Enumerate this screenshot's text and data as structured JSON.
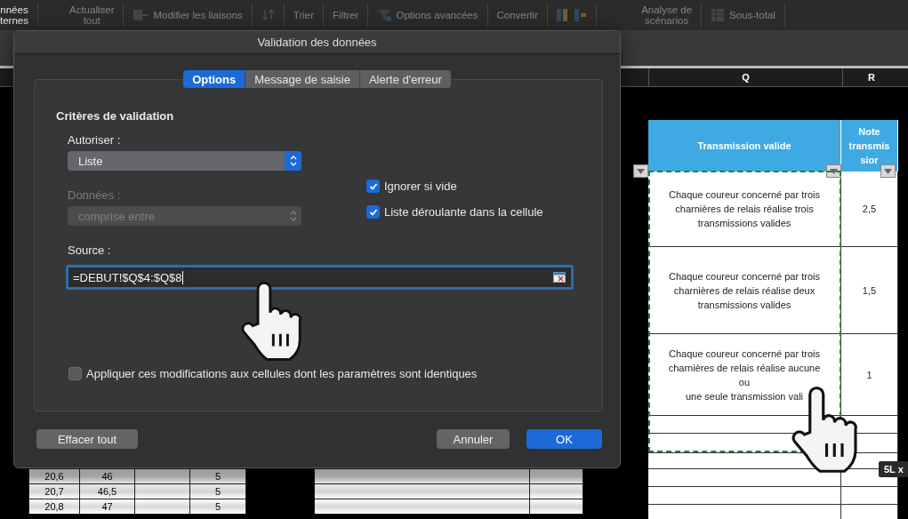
{
  "toolbar": {
    "items": [
      {
        "kind": "text",
        "label": "nnées\nternes",
        "disabled": false
      },
      {
        "kind": "text",
        "label": "Actualiser\ntout",
        "disabled": true
      },
      {
        "kind": "link",
        "label": "Modifier les liaisons",
        "disabled": true
      },
      {
        "kind": "sort",
        "disabled": true
      },
      {
        "kind": "text",
        "label": "Trier",
        "disabled": true
      },
      {
        "kind": "text",
        "label": "Filtrer",
        "disabled": true
      },
      {
        "kind": "funnel",
        "label": "Options avancées",
        "disabled": true
      },
      {
        "kind": "text",
        "label": "Convertir",
        "disabled": true
      },
      {
        "kind": "columns",
        "disabled": true
      },
      {
        "kind": "text",
        "label": "Analyse de\nscénarios",
        "disabled": true
      },
      {
        "kind": "table",
        "label": "Sous-total",
        "disabled": true
      }
    ]
  },
  "sheet": {
    "column_headers": [
      "Q",
      "R"
    ],
    "table": {
      "columns": [
        "Transmission valide",
        "Note\ntransmis\nsior"
      ],
      "rows": [
        {
          "text": "Chaque coureur concerné par trois\ncharnières de relais réalise trois\ntransmissions valides",
          "note": "2,5"
        },
        {
          "text": "Chaque coureur concerné par trois\ncharnières de relais réalise deux\ntransmissions valides",
          "note": "1,5"
        },
        {
          "text": "Chaque coureur concerné par trois\ncharnières de relais réalise aucune\nou\nune seule transmission vali",
          "note": "1"
        }
      ]
    },
    "left_table": {
      "rows": [
        {
          "col_1": "20,6",
          "col_2": "46",
          "col_4": "5"
        },
        {
          "col_1": "20,7",
          "col_2": "46,5",
          "col_4": "5"
        },
        {
          "col_1": "20,8",
          "col_2": "47",
          "col_4": "5"
        }
      ]
    },
    "tooltip": "5L x"
  },
  "dialog": {
    "title": "Validation des données",
    "tabs": [
      {
        "label": "Options",
        "selected": true
      },
      {
        "label": "Message de saisie",
        "selected": false
      },
      {
        "label": "Alerte d'erreur",
        "selected": false
      }
    ],
    "section_title": "Critères de validation",
    "allow": {
      "label": "Autoriser :",
      "value": "Liste",
      "disabled": false
    },
    "data": {
      "label": "Données :",
      "value": "comprise entre",
      "disabled": true
    },
    "checkboxes": [
      {
        "label": "Ignorer si vide",
        "checked": true
      },
      {
        "label": "Liste déroulante dans la cellule",
        "checked": true
      }
    ],
    "source": {
      "label": "Source :",
      "value": "=DEBUT!$Q$4:$Q$8"
    },
    "apply": {
      "label": "Appliquer ces modifications aux cellules dont les paramètres sont identiques",
      "checked": false
    },
    "buttons": [
      {
        "label": "Effacer tout",
        "kind": "secondary"
      },
      {
        "label": "Annuler",
        "kind": "secondary"
      },
      {
        "label": "OK",
        "kind": "default"
      }
    ]
  }
}
